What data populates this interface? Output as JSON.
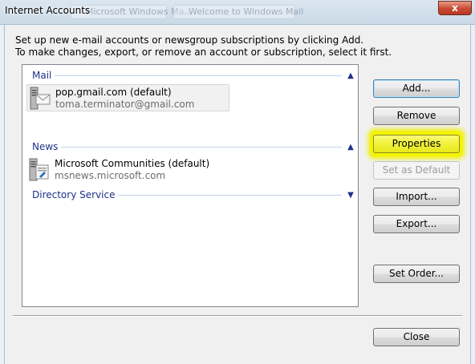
{
  "window": {
    "title": "Internet Accounts",
    "close_glyph": "x",
    "background_tabs": [
      "Microsoft Windows Ma...",
      "Welcome to Windows Mail"
    ]
  },
  "intro": {
    "line1": "Set up new e-mail accounts or newsgroup subscriptions by clicking Add.",
    "line2": "To make changes, export, or remove an account or subscription, select it first."
  },
  "groups": {
    "mail": {
      "title": "Mail",
      "chevron": "up",
      "items": [
        {
          "name": "pop.gmail.com (default)",
          "sub": "toma.terminator@gmail.com",
          "icon": "mail-server-icon",
          "selected": true
        }
      ]
    },
    "news": {
      "title": "News",
      "chevron": "up",
      "items": [
        {
          "name": "Microsoft Communities (default)",
          "sub": "msnews.microsoft.com",
          "icon": "news-server-icon",
          "selected": false
        }
      ]
    },
    "directory": {
      "title": "Directory Service",
      "chevron": "down",
      "items": []
    }
  },
  "buttons": {
    "add": "Add...",
    "remove": "Remove",
    "properties": "Properties",
    "set_default": "Set as Default",
    "import": "Import...",
    "export": "Export...",
    "set_order": "Set Order...",
    "close": "Close"
  },
  "colors": {
    "group_header": "#1e3287",
    "highlight": "#f4f400",
    "close_button": "#c94a33"
  }
}
